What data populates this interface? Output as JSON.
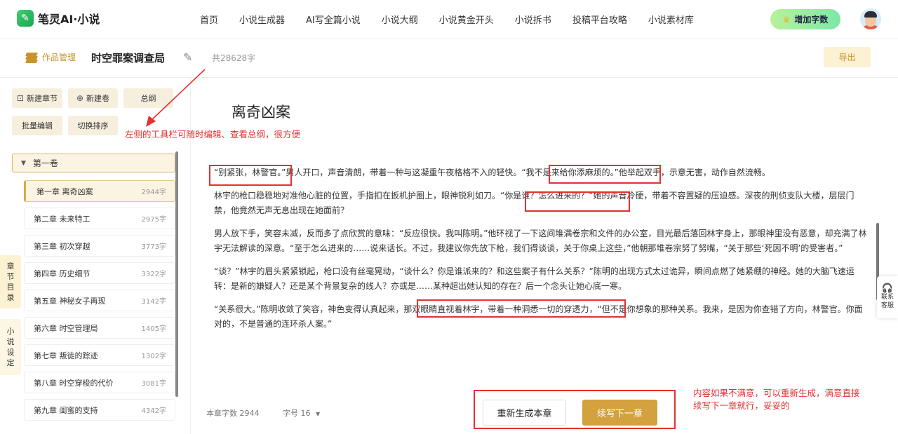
{
  "app": {
    "logo_text": "笔灵AI·小说"
  },
  "nav": {
    "items": [
      "首页",
      "小说生成器",
      "AI写全篇小说",
      "小说大纲",
      "小说黄金开头",
      "小说拆书",
      "投稿平台攻略",
      "小说素材库"
    ],
    "add_words": "增加字数"
  },
  "workbar": {
    "work_mgmt": "作品管理",
    "title": "时空罪案调查局",
    "total": "共28628字",
    "export": "导出"
  },
  "sidebar": {
    "new_chapter": "新建章节",
    "new_volume": "新建卷",
    "outline": "总纲",
    "batch_edit": "批量编辑",
    "switch_sort": "切换排序",
    "volume": "第一卷",
    "chapters": [
      {
        "label": "第一章 离奇凶案",
        "count": "2944字"
      },
      {
        "label": "第二章 未来特工",
        "count": "2975字"
      },
      {
        "label": "第三章 初次穿越",
        "count": "3773字"
      },
      {
        "label": "第四章 历史细节",
        "count": "3322字"
      },
      {
        "label": "第五章 神秘女子再现",
        "count": "3142字"
      },
      {
        "label": "第六章 时空管理局",
        "count": "1405字"
      },
      {
        "label": "第七章 叛徒的踪迹",
        "count": "1302字"
      },
      {
        "label": "第八章 时空穿梭的代价",
        "count": "3081字"
      },
      {
        "label": "第九章 闺蜜的支持",
        "count": "4342字"
      }
    ],
    "tab_catalog": [
      "章",
      "节",
      "目",
      "录"
    ],
    "tab_settings": [
      "小",
      "说",
      "设",
      "定"
    ]
  },
  "main": {
    "chapter_title": "离奇凶案",
    "paragraphs": [
      "“别紧张，林警官。”男人开口，声音清朗，带着一种与这凝重午夜格格不入的轻快。“我不是来给你添麻烦的。”他举起双手，示意无害，动作自然流畅。",
      "林宇的枪口稳稳地对准他心脏的位置，手指扣在扳机护圈上，眼神锐利如刀。“你是谁？怎么进来的？”她的声音冷硬，带着不容置疑的压迫感。深夜的刑侦支队大楼，层层门禁，他竟然无声无息出现在她面前？",
      "男人放下手，笑容未减，反而多了点欣赏的意味：“反应很快。我叫陈明。”他环视了一下这间堆满卷宗和文件的办公室，目光最后落回林宇身上，那眼神里没有恶意，却充满了林宇无法解读的深意。“至于怎么进来的……说来话长。不过，我建议你先放下枪，我们得谈谈，关于你桌上这些，”他朝那堆卷宗努了努嘴，“关于那些‘死因不明’的受害者。”",
      "“谈？”林宇的眉头紧紧锁起，枪口没有丝毫晃动，“谈什么？你是谁派来的？和这些案子有什么关系？”陈明的出现方式太过诡异，瞬间点燃了她紧绷的神经。她的大脑飞速运转：是新的嫌疑人？还是某个背景复杂的线人？亦或是……某种超出她认知的存在？后一个念头让她心底一寒。",
      "“关系很大。”陈明收敛了笑容，神色变得认真起来，那双眼睛直视着林宇，带着一种洞悉一切的穿透力，“但不是你想象的那种关系。我来，是因为你查错了方向，林警官。你面对的，不是普通的连环杀人案。”"
    ],
    "word_count": "本章字数 2944",
    "font_size": "字号 16",
    "regen": "重新生成本章",
    "continue": "续写下一章"
  },
  "annotations": {
    "left_tools": "左侧的工具栏可随时编辑、查看总纲，很方便",
    "bottom_right_1": "内容如果不满意，可以重新生成，满意直接",
    "bottom_right_2": "续写下一章就行，妥妥的"
  },
  "service": {
    "line1": "联系",
    "line2": "客服"
  },
  "colors": {
    "accent": "#d4a13f",
    "annotation": "#e53030",
    "highlight_bg": "#fcf4e2"
  }
}
